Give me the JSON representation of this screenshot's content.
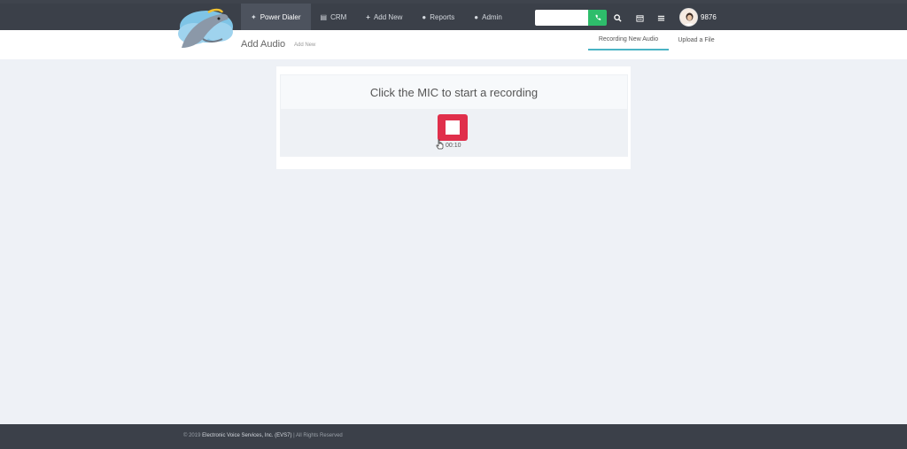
{
  "nav": {
    "items": [
      {
        "label": "Power Dialer",
        "icon": "wand-icon",
        "active": true
      },
      {
        "label": "CRM",
        "icon": "book-icon"
      },
      {
        "label": "Add New",
        "icon": "plus-icon"
      },
      {
        "label": "Reports",
        "icon": "user-icon"
      },
      {
        "label": "Admin",
        "icon": "user-icon"
      }
    ]
  },
  "header": {
    "search_value": "",
    "user_number": "9876"
  },
  "page": {
    "title": "Add Audio",
    "subtitle": "Add New"
  },
  "tabs": [
    {
      "label": "Recording New Audio",
      "active": true
    },
    {
      "label": "Upload a File"
    }
  ],
  "recorder": {
    "prompt": "Click the MIC to start a recording",
    "timer": "00:10"
  },
  "footer": {
    "prefix": "© 2019",
    "company": "Electronic Voice Services, Inc. (EVS7)",
    "suffix": "| All Rights Reserved"
  },
  "colors": {
    "topbar": "#3b4049",
    "call_button": "#2ebd6b",
    "stop_button": "#e02f4b",
    "tab_underline": "#4ab3c4"
  }
}
